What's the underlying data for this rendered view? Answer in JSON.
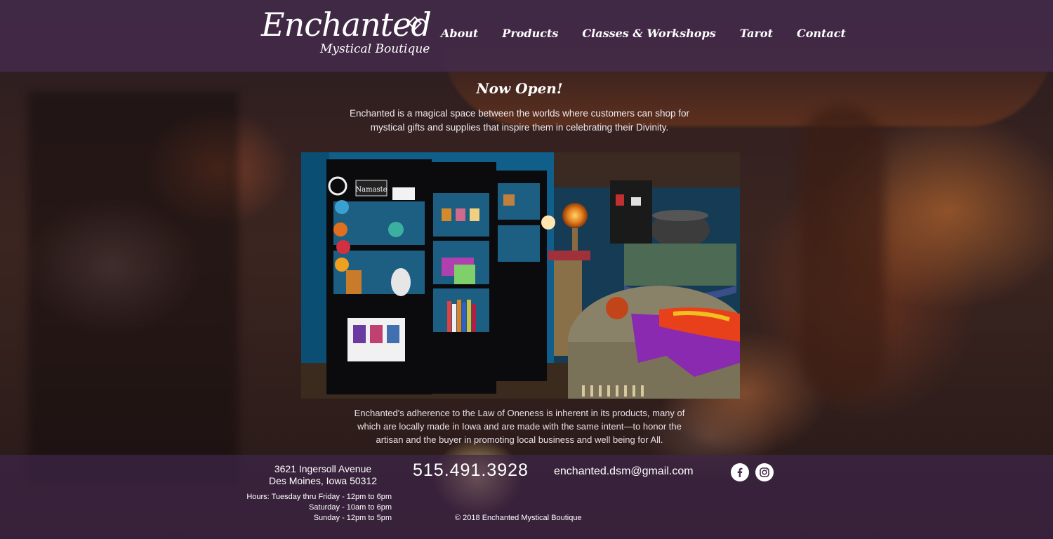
{
  "brand": {
    "logo_main": "Enchanted",
    "logo_sub": "Mystical Boutique"
  },
  "nav": {
    "items": [
      {
        "label": "About"
      },
      {
        "label": "Products"
      },
      {
        "label": "Classes & Workshops"
      },
      {
        "label": "Tarot"
      },
      {
        "label": "Contact"
      }
    ]
  },
  "main": {
    "headline": "Now Open!",
    "intro": "Enchanted is a magical space between the worlds where customers can shop for mystical gifts and supplies that inspire them in celebrating their Divinity.",
    "photo_sign": "Namaste",
    "body": "Enchanted's adherence to the Law of Oneness is inherent in its products, many of which are locally made in Iowa and are made with the same intent—to honor the artisan and the buyer in promoting local business and well being for All."
  },
  "footer": {
    "address_line1": "3621 Ingersoll Avenue",
    "address_line2": "Des Moines, Iowa 50312",
    "hours": [
      "Hours: Tuesday thru Friday - 12pm to 6pm",
      "Saturday - 10am to 6pm",
      "Sunday - 12pm to 5pm"
    ],
    "phone": "515.491.3928",
    "email": "enchanted.dsm@gmail.com",
    "copyright": "© 2018 Enchanted Mystical Boutique",
    "social": [
      {
        "icon": "facebook-icon"
      },
      {
        "icon": "instagram-icon"
      }
    ]
  },
  "colors": {
    "header_bg": "#462d50",
    "footer_bg": "#3e2648",
    "text": "#ffffff"
  }
}
